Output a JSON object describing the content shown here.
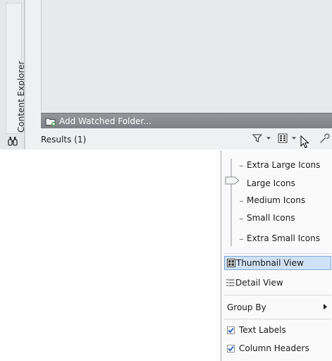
{
  "side_tab": {
    "label": "Content Explorer",
    "icon": "binoculars-icon"
  },
  "watch_bar": {
    "add_label": "Add Watched Folder..."
  },
  "results": {
    "label": "Results (1)"
  },
  "toolbar": {
    "filter_icon": "filter-icon",
    "view_icon": "view-icon",
    "settings_icon": "wrench-icon"
  },
  "menu": {
    "sizes": [
      "Extra Large Icons",
      "Large Icons",
      "Medium Icons",
      "Small Icons",
      "Extra Small Icons"
    ],
    "selected_size": "Large Icons",
    "thumbnail_view": "Thumbnail View",
    "detail_view": "Detail View",
    "group_by": "Group By",
    "text_labels": "Text Labels",
    "column_headers": "Column Headers",
    "text_labels_checked": true,
    "column_headers_checked": true
  },
  "colors": {
    "accent": "#cfe1f5",
    "watch_bar": "#8a8d91",
    "check": "#1f5fbf"
  }
}
